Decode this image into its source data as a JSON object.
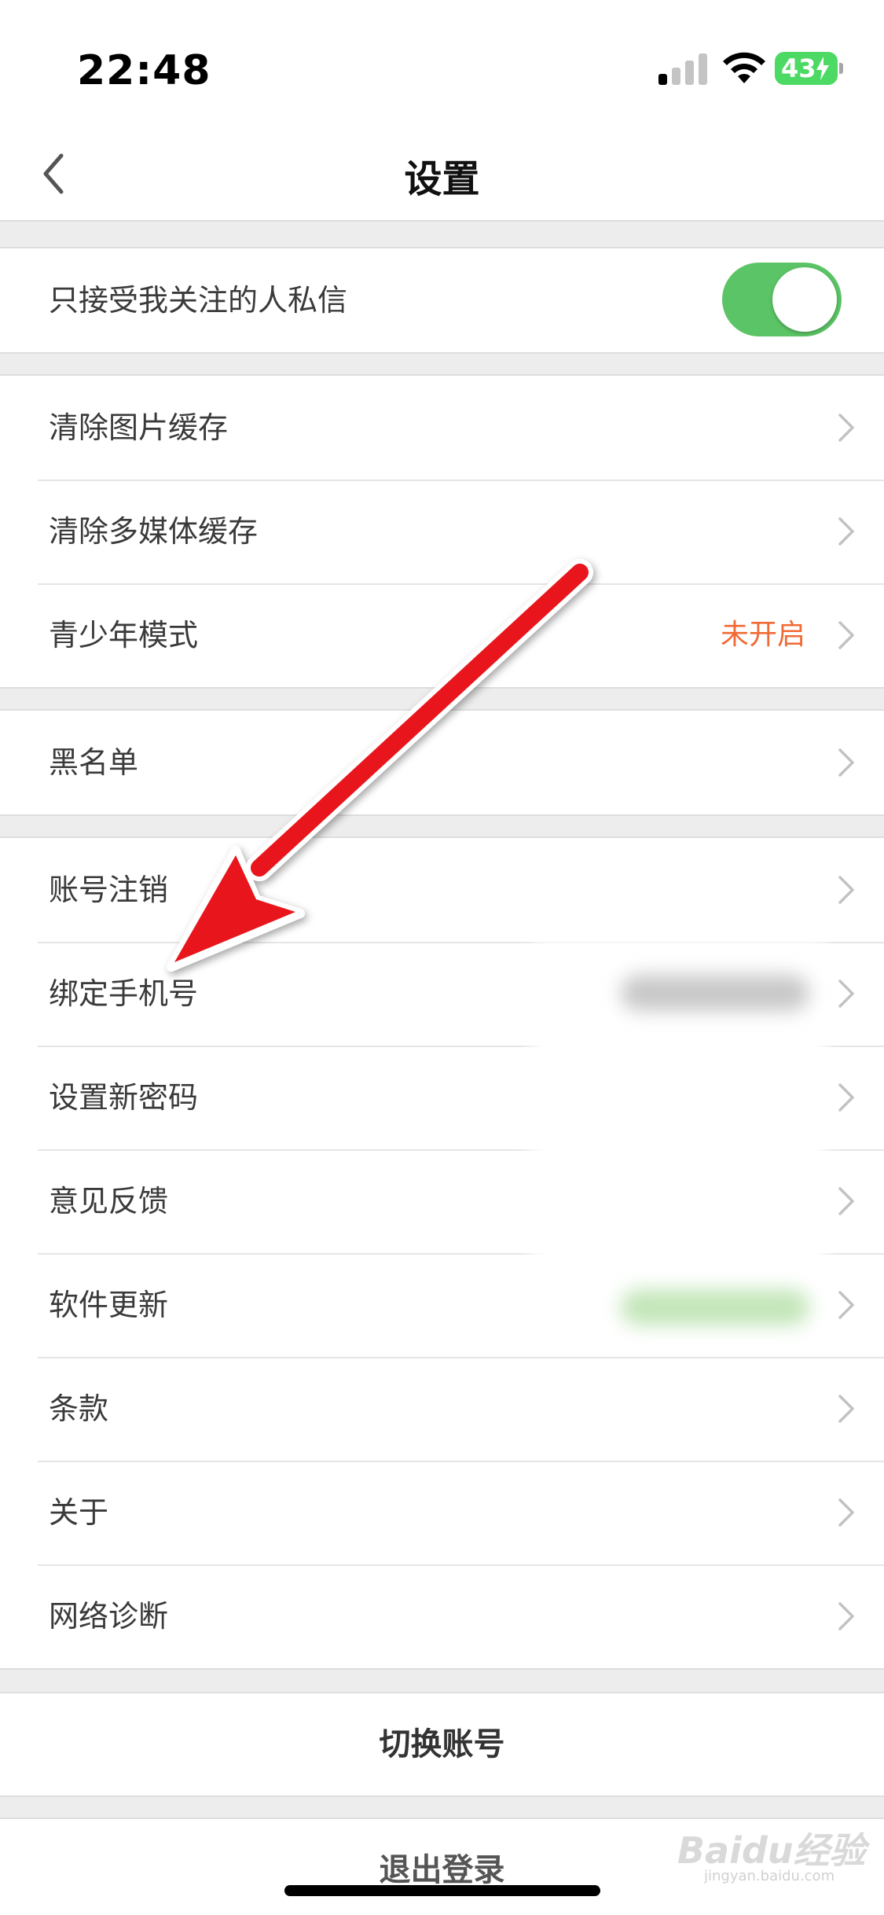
{
  "status_bar": {
    "time": "22:48",
    "battery": "43"
  },
  "nav": {
    "title": "设置",
    "back_icon": "chevron-left-icon"
  },
  "groups": {
    "privacy": {
      "dm_only_followed": {
        "label": "只接受我关注的人私信",
        "enabled": true
      }
    },
    "cache": {
      "items": [
        {
          "label": "清除图片缓存"
        },
        {
          "label": "清除多媒体缓存"
        },
        {
          "label": "青少年模式",
          "status": "未开启"
        }
      ]
    },
    "blacklist": {
      "items": [
        {
          "label": "黑名单"
        }
      ]
    },
    "account": {
      "items": [
        {
          "label": "账号注销"
        },
        {
          "label": "绑定手机号"
        },
        {
          "label": "设置新密码"
        },
        {
          "label": "意见反馈"
        },
        {
          "label": "软件更新"
        },
        {
          "label": "条款"
        },
        {
          "label": "关于"
        },
        {
          "label": "网络诊断"
        }
      ]
    },
    "switch_account": {
      "label": "切换账号"
    },
    "logout": {
      "label": "退出登录"
    }
  },
  "colors": {
    "toggle_on": "#5bc466",
    "status_orange": "#f06a35",
    "annotation_arrow": "#e8141a"
  },
  "watermark": {
    "logo": "Baidu经验",
    "url": "jingyan.baidu.com"
  }
}
